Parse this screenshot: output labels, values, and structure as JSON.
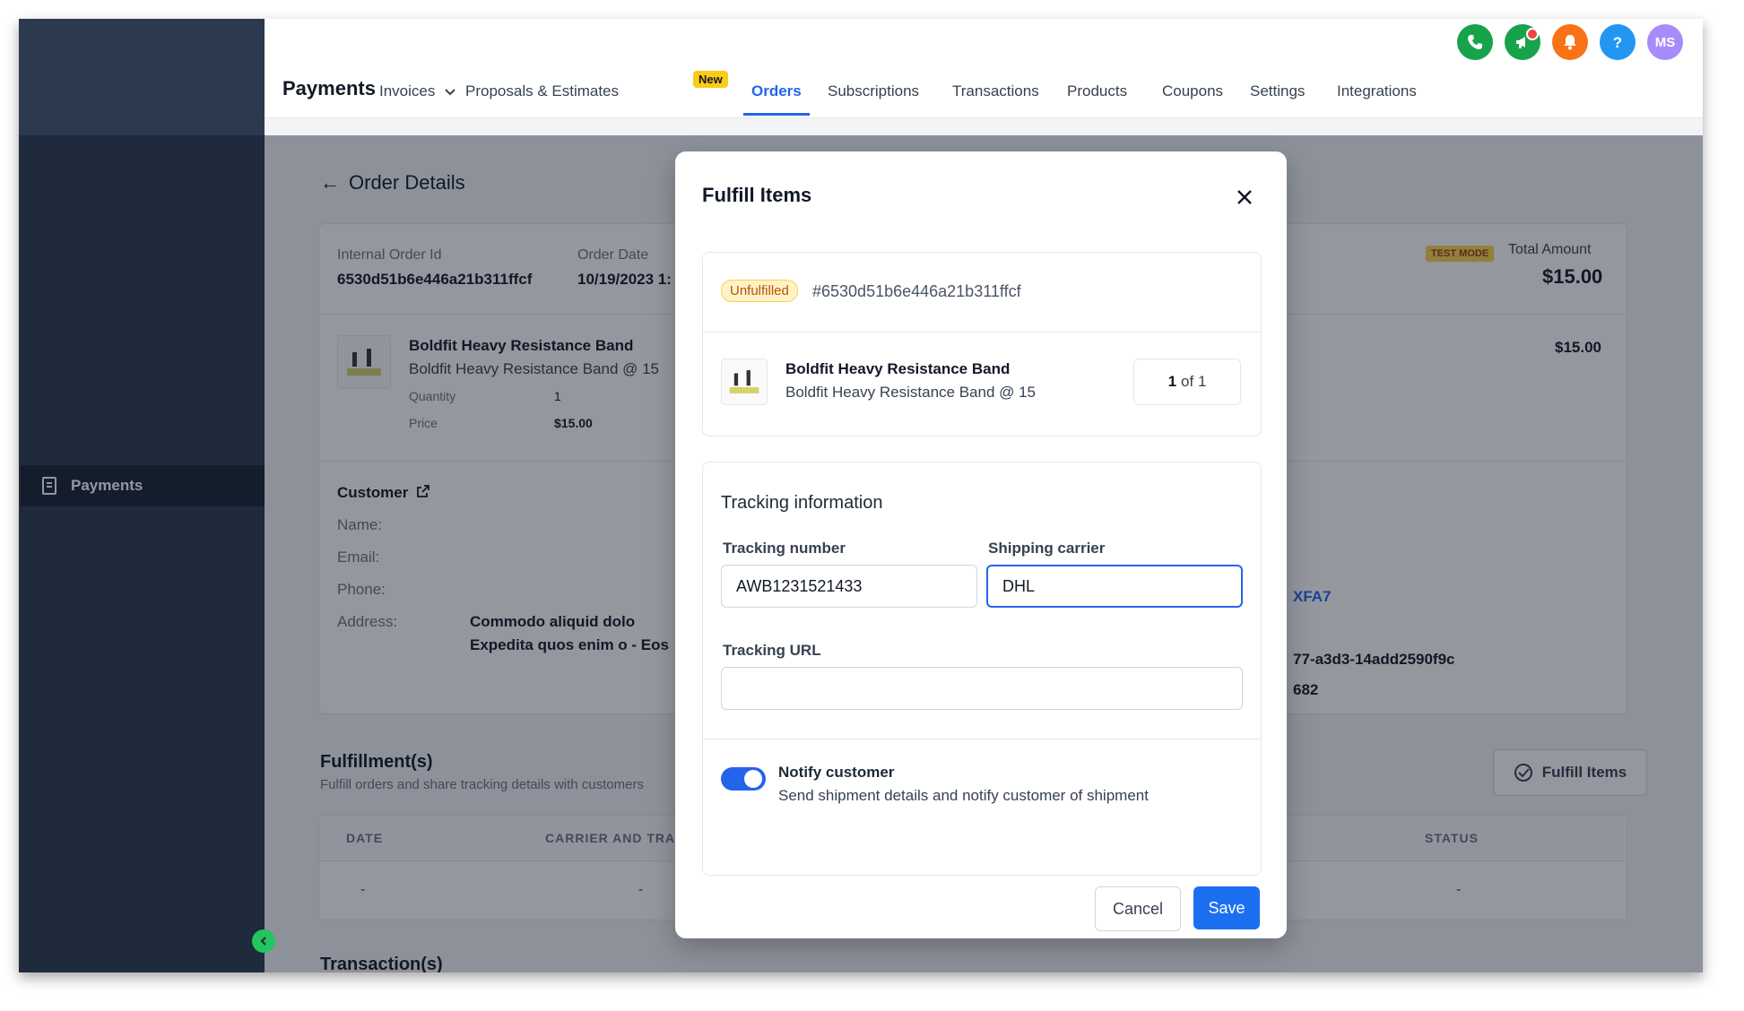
{
  "sidebar": {
    "items": [
      {
        "label": "Payments",
        "icon": "receipt-icon"
      }
    ]
  },
  "header": {
    "brand": "Payments",
    "nav": {
      "invoices": "Invoices",
      "proposals": "Proposals & Estimates",
      "new_badge": "New",
      "orders": "Orders",
      "subscriptions": "Subscriptions",
      "transactions": "Transactions",
      "products": "Products",
      "coupons": "Coupons",
      "settings": "Settings",
      "integrations": "Integrations"
    },
    "icons": [
      "phone-icon",
      "megaphone-icon",
      "bell-icon",
      "help-icon"
    ],
    "avatar_initials": "MS",
    "colors": {
      "phone": "#16a34a",
      "megaphone": "#16a34a",
      "bell": "#f97316",
      "help": "#2196f3"
    }
  },
  "page": {
    "title": "Order Details",
    "order": {
      "internal_id_label": "Internal Order Id",
      "internal_id": "6530d51b6e446a21b311ffcf",
      "order_date_label": "Order Date",
      "order_date": "10/19/2023 1:",
      "test_mode": "TEST MODE",
      "total_label": "Total Amount",
      "total": "$15.00"
    },
    "item": {
      "name": "Boldfit Heavy Resistance Band",
      "variant": "Boldfit Heavy Resistance Band @ 15",
      "quantity_label": "Quantity",
      "quantity": "1",
      "price_label": "Price",
      "price": "$15.00",
      "line_total": "$15.00"
    },
    "customer": {
      "title": "Customer",
      "name_label": "Name:",
      "email_label": "Email:",
      "phone_label": "Phone:",
      "address_label": "Address:",
      "address_line1": "Commodo aliquid dolo",
      "address_line2": "Expedita quos enim o - Eos",
      "partial_1": "XFA7",
      "partial_2": "77-a3d3-14add2590f9c",
      "partial_3": "682"
    },
    "fulfillments": {
      "title": "Fulfillment(s)",
      "subtitle": "Fulfill orders and share tracking details with customers",
      "button": "Fulfill Items",
      "columns": {
        "date": "DATE",
        "carrier": "CARRIER AND TRA",
        "status": "STATUS"
      },
      "row": {
        "date": "-",
        "carrier": "-",
        "status": "-"
      }
    },
    "transactions_title": "Transaction(s)"
  },
  "modal": {
    "title": "Fulfill Items",
    "status": "Unfulfilled",
    "order_ref": "#6530d51b6e446a21b311ffcf",
    "item_name": "Boldfit Heavy Resistance Band",
    "item_variant": "Boldfit Heavy Resistance Band @ 15",
    "qty_current": "1",
    "qty_of": "of 1",
    "tracking_title": "Tracking information",
    "tracking_number_label": "Tracking number",
    "tracking_number": "AWB1231521433",
    "carrier_label": "Shipping carrier",
    "carrier": "DHL",
    "url_label": "Tracking URL",
    "url": "",
    "notify_title": "Notify customer",
    "notify_desc": "Send shipment details and notify customer of shipment",
    "notify_on": true,
    "cancel": "Cancel",
    "save": "Save"
  }
}
